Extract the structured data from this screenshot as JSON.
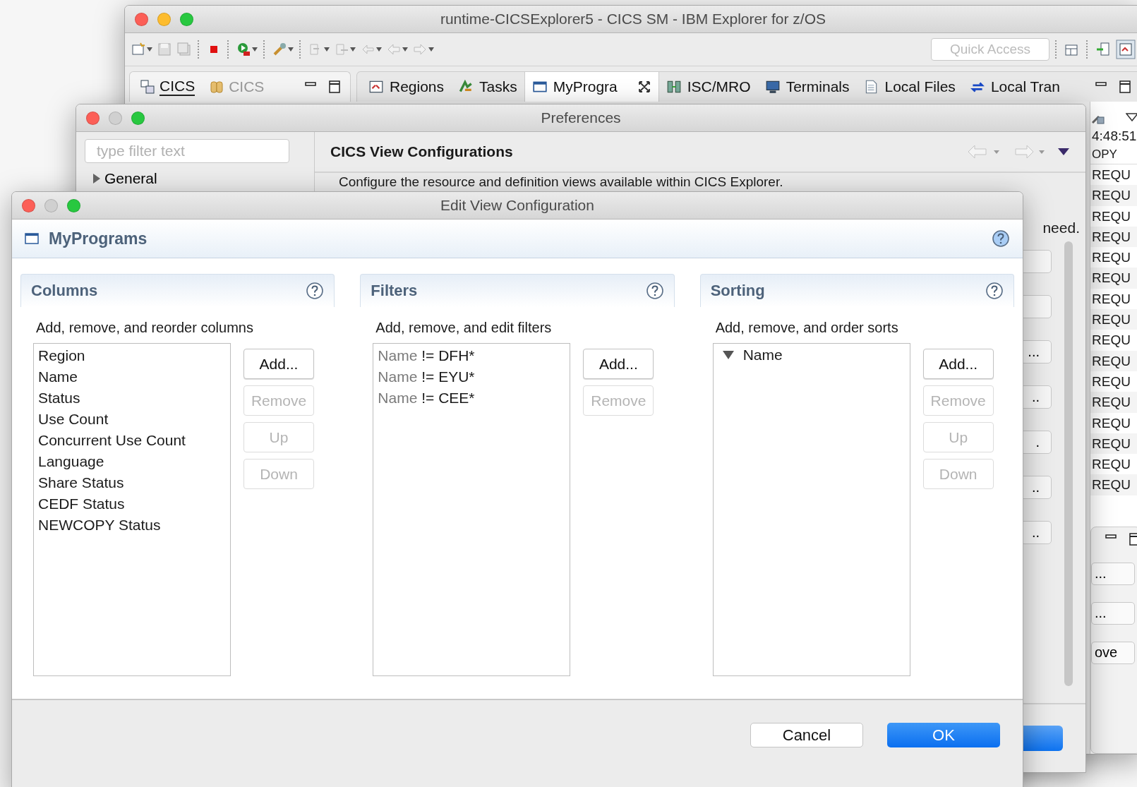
{
  "main_window": {
    "title": "runtime-CICSExplorer5 - CICS SM - IBM Explorer for z/OS",
    "quick_access": {
      "placeholder": "Quick Access"
    },
    "perspective_tabs": [
      {
        "label": "CICS",
        "selected": true
      },
      {
        "label": "CICS",
        "selected": false
      }
    ],
    "view_tabs": [
      {
        "label": "Regions",
        "selected": false
      },
      {
        "label": "Tasks",
        "selected": false
      },
      {
        "label": "MyProgra",
        "selected": true
      },
      {
        "label": "ISC/MRO",
        "selected": false
      },
      {
        "label": "Terminals",
        "selected": false
      },
      {
        "label": "Local Files",
        "selected": false
      },
      {
        "label": "Local Tran",
        "selected": false
      }
    ],
    "side_table": {
      "time": "4:48:51",
      "header": "OPY",
      "rows": [
        "REQU",
        "REQU",
        "REQU",
        "REQU",
        "REQU",
        "REQU",
        "REQU",
        "REQU",
        "REQU",
        "REQU",
        "REQU",
        "REQU",
        "REQU",
        "REQU",
        "REQU",
        "REQU"
      ]
    },
    "lower_panel": {
      "buttons": [
        "...",
        "...",
        "ove"
      ]
    }
  },
  "preferences": {
    "title": "Preferences",
    "filter": {
      "placeholder": "type filter text"
    },
    "tree": [
      {
        "label": "General",
        "expanded": false
      }
    ],
    "page_title": "CICS View Configurations",
    "description": "Configure the resource and definition views available within CICS Explorer.",
    "trailing_text": "need.",
    "side_buttons": [
      "...",
      "..",
      ".",
      "..",
      ".."
    ]
  },
  "edit_dialog": {
    "title": "Edit View Configuration",
    "header": "MyPrograms",
    "sections": [
      {
        "kind": "columns",
        "title": "Columns",
        "description": "Add, remove, and reorder columns",
        "items": [
          "Region",
          "Name",
          "Status",
          "Use Count",
          "Concurrent Use Count",
          "Language",
          "Share Status",
          "CEDF Status",
          "NEWCOPY Status"
        ],
        "buttons": [
          {
            "label": "Add...",
            "disabled": false
          },
          {
            "label": "Remove",
            "disabled": true
          },
          {
            "label": "Up",
            "disabled": true
          },
          {
            "label": "Down",
            "disabled": true
          }
        ]
      },
      {
        "kind": "filters",
        "title": "Filters",
        "description": "Add, remove, and edit filters",
        "items": [
          {
            "attribute": "Name",
            "condition": "!= DFH*"
          },
          {
            "attribute": "Name",
            "condition": "!= EYU*"
          },
          {
            "attribute": "Name",
            "condition": "!= CEE*"
          }
        ],
        "buttons": [
          {
            "label": "Add...",
            "disabled": false
          },
          {
            "label": "Remove",
            "disabled": true
          }
        ]
      },
      {
        "kind": "sorting",
        "title": "Sorting",
        "description": "Add, remove, and order sorts",
        "items": [
          {
            "label": "Name",
            "descending": true
          }
        ],
        "buttons": [
          {
            "label": "Add...",
            "disabled": false
          },
          {
            "label": "Remove",
            "disabled": true
          },
          {
            "label": "Up",
            "disabled": true
          },
          {
            "label": "Down",
            "disabled": true
          }
        ]
      }
    ],
    "footer_buttons": [
      {
        "label": "Cancel",
        "default": false
      },
      {
        "label": "OK",
        "default": true
      }
    ]
  }
}
